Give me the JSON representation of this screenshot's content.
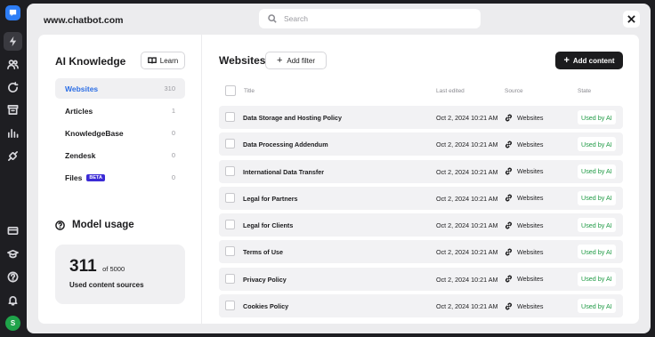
{
  "window": {
    "url": "www.chatbot.com"
  },
  "search": {
    "placeholder": "Search"
  },
  "panel": {
    "title": "AI Knowledge",
    "learn_label": "Learn",
    "nav": [
      {
        "label": "Websites",
        "count": "310"
      },
      {
        "label": "Articles",
        "count": "1"
      },
      {
        "label": "KnowledgeBase",
        "count": "0"
      },
      {
        "label": "Zendesk",
        "count": "0"
      },
      {
        "label": "Files",
        "count": "0",
        "badge": "BETA"
      }
    ],
    "usage": {
      "title": "Model usage",
      "used": "311",
      "of": "of 5000",
      "label": "Used content sources"
    }
  },
  "main": {
    "title": "Websites",
    "add_filter_label": "Add filter",
    "add_content_label": "Add content",
    "columns": {
      "title": "Title",
      "last_edited": "Last edited",
      "source": "Source",
      "state": "State"
    },
    "rows": [
      {
        "title": "Data Storage and Hosting Policy",
        "date": "Oct 2, 2024 10:21 AM",
        "source": "Websites",
        "state": "Used by AI"
      },
      {
        "title": "Data Processing Addendum",
        "date": "Oct 2, 2024 10:21 AM",
        "source": "Websites",
        "state": "Used by AI"
      },
      {
        "title": "International Data Transfer",
        "date": "Oct 2, 2024 10:21 AM",
        "source": "Websites",
        "state": "Used by AI"
      },
      {
        "title": "Legal for Partners",
        "date": "Oct 2, 2024 10:21 AM",
        "source": "Websites",
        "state": "Used by AI"
      },
      {
        "title": "Legal for Clients",
        "date": "Oct 2, 2024 10:21 AM",
        "source": "Websites",
        "state": "Used by AI"
      },
      {
        "title": "Terms of Use",
        "date": "Oct 2, 2024 10:21 AM",
        "source": "Websites",
        "state": "Used by AI"
      },
      {
        "title": "Privacy Policy",
        "date": "Oct 2, 2024 10:21 AM",
        "source": "Websites",
        "state": "Used by AI"
      },
      {
        "title": "Cookies Policy",
        "date": "Oct 2, 2024 10:21 AM",
        "source": "Websites",
        "state": "Used by AI"
      }
    ]
  },
  "user": {
    "initial": "S"
  },
  "colors": {
    "accent": "#2d6fe6",
    "brand": "#2d7df6",
    "success": "#1f9a45",
    "beta": "#3b2bd6"
  }
}
